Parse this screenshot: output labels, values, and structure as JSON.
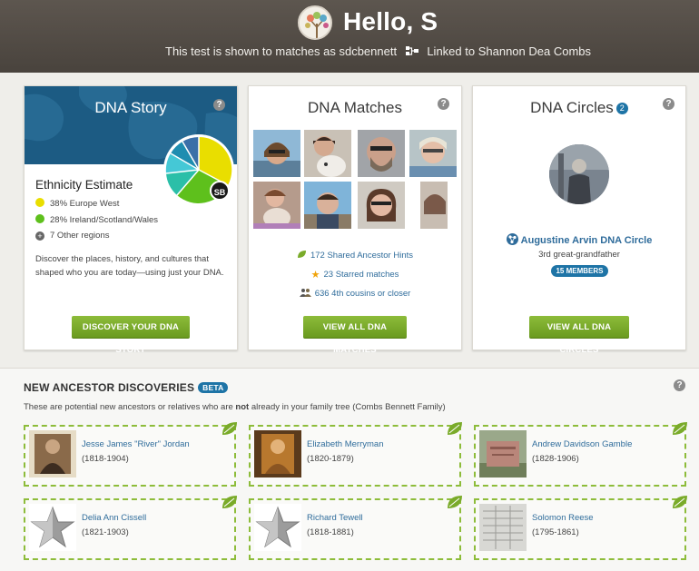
{
  "header": {
    "greeting": "Hello, S",
    "test_shown_text": "This test is shown to matches as sdcbennett",
    "linked_text": "Linked to Shannon Dea Combs"
  },
  "dna_story": {
    "title": "DNA Story",
    "ethnicity_title": "Ethnicity Estimate",
    "regions": [
      {
        "label": "38% Europe West",
        "color": "#e9de00"
      },
      {
        "label": "28% Ireland/Scotland/Wales",
        "color": "#5ec01c"
      },
      {
        "label": "7 Other regions",
        "color": "#666666"
      }
    ],
    "initials": "SB",
    "description": "Discover the places, history, and cultures that shaped who you are today—using just your DNA.",
    "button": "DISCOVER YOUR DNA STORY"
  },
  "dna_matches": {
    "title": "DNA Matches",
    "stats": [
      {
        "label": "172 Shared Ancestor Hints",
        "icon": "leaf-icon"
      },
      {
        "label": "23 Starred matches",
        "icon": "star-icon"
      },
      {
        "label": "636 4th cousins or closer",
        "icon": "people-icon"
      }
    ],
    "button": "VIEW ALL DNA MATCHES"
  },
  "dna_circles": {
    "title": "DNA Circles",
    "count": "2",
    "circle_name": "Augustine Arvin DNA Circle",
    "relationship": "3rd great-grandfather",
    "members": "15 MEMBERS",
    "button": "VIEW ALL DNA CIRCLES"
  },
  "new_ancestors": {
    "title": "NEW ANCESTOR DISCOVERIES",
    "beta": "BETA",
    "subtitle_pre": "These are potential new ancestors or relatives who are ",
    "subtitle_bold": "not",
    "subtitle_post": " already in your family tree (Combs Bennett Family)",
    "items": [
      {
        "name": "Jesse James \"River\" Jordan",
        "dates": "(1818-1904)"
      },
      {
        "name": "Elizabeth Merryman",
        "dates": "(1820-1879)"
      },
      {
        "name": "Andrew Davidson Gamble",
        "dates": "(1828-1906)"
      },
      {
        "name": "Delia Ann Cissell",
        "dates": "(1821-1903)"
      },
      {
        "name": "Richard Tewell",
        "dates": "(1818-1881)"
      },
      {
        "name": "Solomon Reese",
        "dates": "(1795-1861)"
      }
    ]
  },
  "colors": {
    "accent_blue": "#2f6c9b",
    "button_green": "#7aab2a",
    "badge_blue": "#1e74a6"
  }
}
